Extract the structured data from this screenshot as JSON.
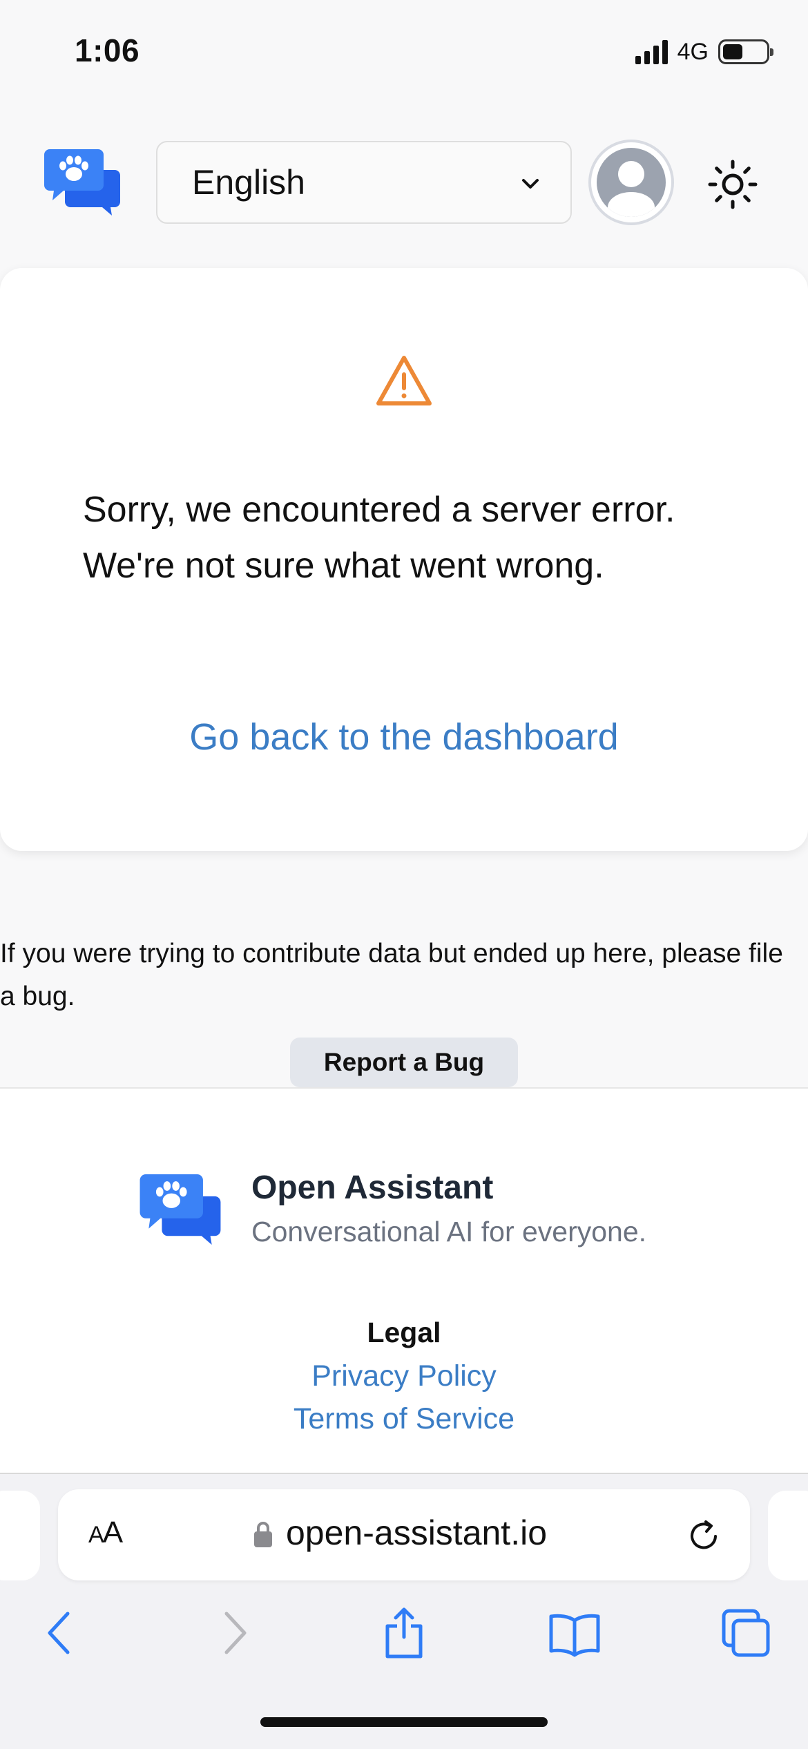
{
  "status_bar": {
    "time": "1:06",
    "network": "4G",
    "battery_level": 0.45
  },
  "header": {
    "logo_icon": "open-assistant-logo-icon",
    "language_select": {
      "value": "English",
      "options": [
        "English"
      ]
    },
    "avatar_icon": "user-avatar-icon",
    "theme_icon": "sun-icon"
  },
  "error_card": {
    "icon": "warning-triangle-icon",
    "icon_color": "#ed8936",
    "message": "Sorry, we encountered a server error. We're not sure what went wrong.",
    "dashboard_link": "Go back to the dashboard"
  },
  "bug_section": {
    "text": "If you were trying to contribute data but ended up here, please file a bug.",
    "button_label": "Report a Bug"
  },
  "footer": {
    "title": "Open Assistant",
    "tagline": "Conversational AI for everyone.",
    "legal_heading": "Legal",
    "links": [
      "Privacy Policy",
      "Terms of Service"
    ]
  },
  "browser": {
    "text_size_button": "AA",
    "url": "open-assistant.io",
    "toolbar_icons": [
      "back-icon",
      "forward-icon",
      "share-icon",
      "bookmarks-icon",
      "tabs-icon"
    ]
  },
  "colors": {
    "brand_blue": "#3b82f6",
    "link_blue": "#3b7dc5",
    "warning_orange": "#ed8936",
    "safari_blue": "#2f7cf6"
  }
}
